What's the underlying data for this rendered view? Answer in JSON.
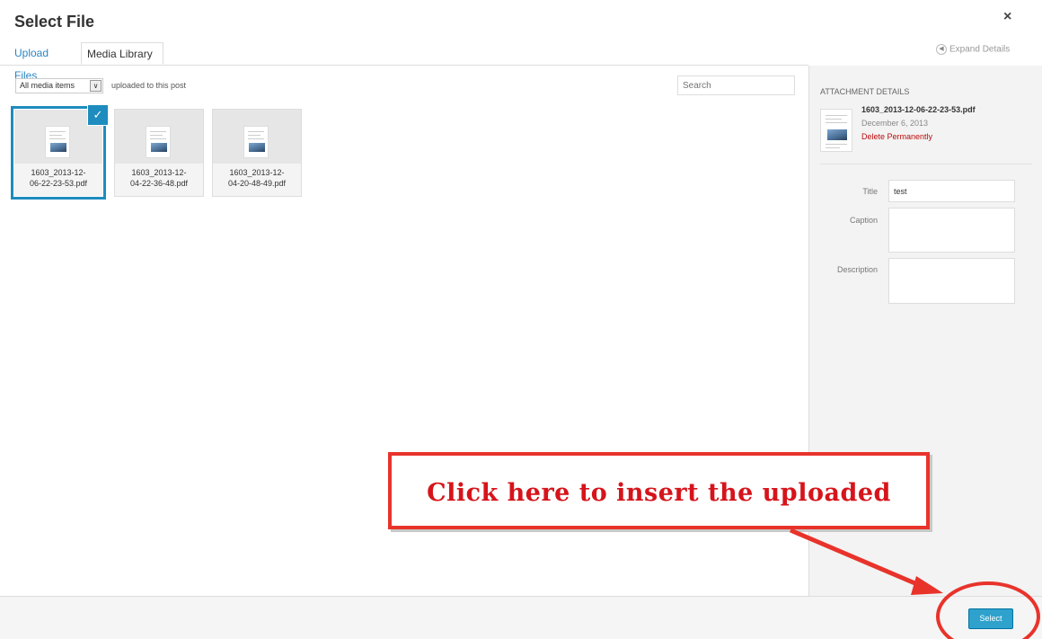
{
  "modal": {
    "title": "Select File",
    "close_glyph": "×",
    "expand_details": "Expand Details"
  },
  "tabs": [
    {
      "label": "Upload Files",
      "active": false
    },
    {
      "label": "Media Library",
      "active": true
    }
  ],
  "toolbar": {
    "filter_value": "All media items",
    "filter_label": "uploaded to this post",
    "search_placeholder": "Search"
  },
  "attachments": [
    {
      "name": "1603_2013-12-06-22-23-53.pdf",
      "line1": "1603_2013-12-",
      "line2": "06-22-23-53.pdf",
      "selected": true
    },
    {
      "name": "1603_2013-12-04-22-36-48.pdf",
      "line1": "1603_2013-12-",
      "line2": "04-22-36-48.pdf",
      "selected": false
    },
    {
      "name": "1603_2013-12-04-20-48-49.pdf",
      "line1": "1603_2013-12-",
      "line2": "04-20-48-49.pdf",
      "selected": false
    }
  ],
  "details": {
    "heading": "ATTACHMENT DETAILS",
    "filename": "1603_2013-12-06-22-23-53.pdf",
    "date": "December 6, 2013",
    "delete_label": "Delete Permanently",
    "fields": {
      "title_label": "Title",
      "title_value": "test",
      "caption_label": "Caption",
      "caption_value": "",
      "description_label": "Description",
      "description_value": ""
    }
  },
  "footer": {
    "select_label": "Select"
  },
  "annotation": {
    "callout_text": "Click here to insert the uploaded",
    "color": "#e8332b"
  },
  "colors": {
    "accent": "#1e8cbe",
    "button": "#2ea2cc",
    "delete": "#bc0b0b",
    "link": "#2a85c2"
  },
  "icons": {
    "check": "checkmark-icon",
    "expand": "arrow-left-circle-icon",
    "dropdown": "chevron-down-icon"
  }
}
